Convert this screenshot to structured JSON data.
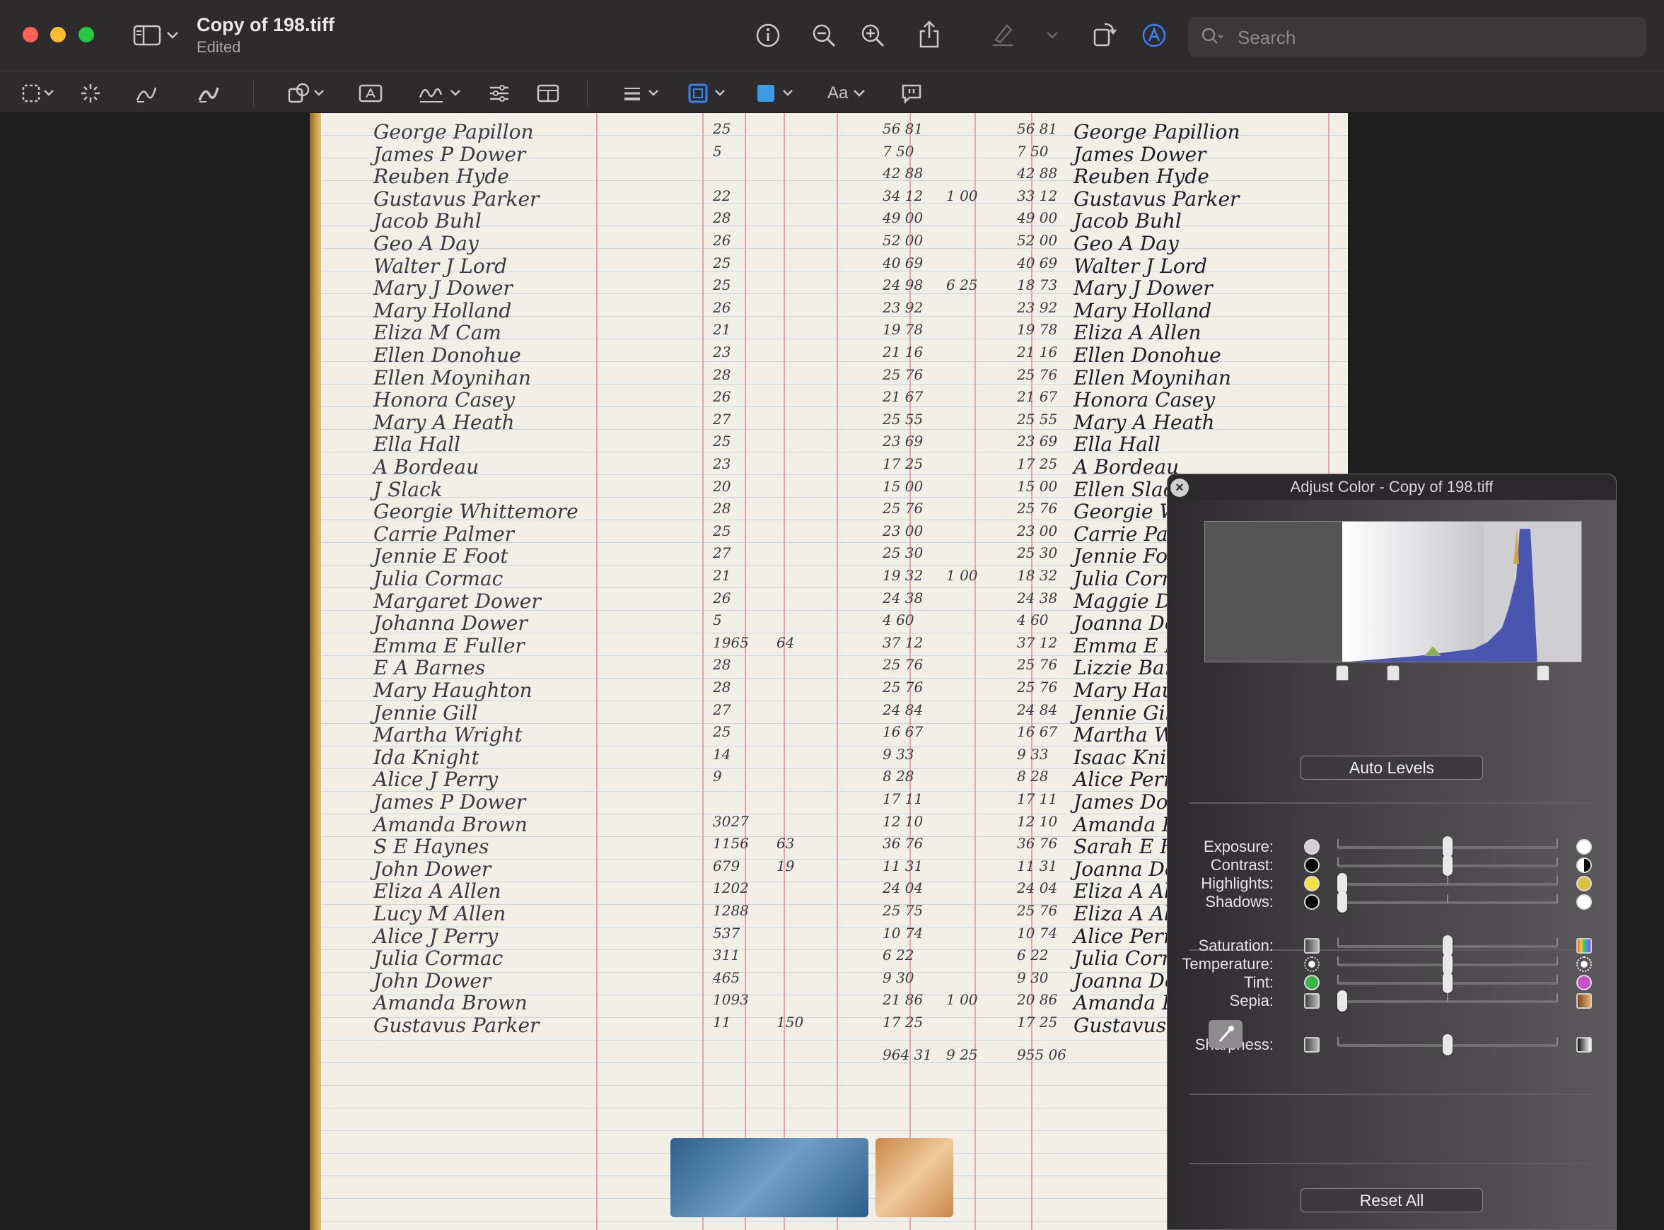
{
  "window": {
    "title": "Copy of 198.tiff",
    "subtitle": "Edited"
  },
  "titlebar_icons": [
    "sidebar-icon",
    "info-icon",
    "zoom-out-icon",
    "zoom-in-icon",
    "share-icon",
    "highlight-pen-icon",
    "rotate-icon",
    "markup-icon"
  ],
  "search": {
    "placeholder": "Search"
  },
  "toolbar": {
    "text_style_label": "Aa"
  },
  "ledger": {
    "rows": [
      {
        "name": "George Papillon",
        "a": "25",
        "b": "",
        "c": "56 81",
        "d": "",
        "e": "56 81",
        "sig": "George Papillion"
      },
      {
        "name": "James P Dower",
        "a": "5",
        "b": "",
        "c": "7 50",
        "d": "",
        "e": "7 50",
        "sig": "James Dower"
      },
      {
        "name": "Reuben Hyde",
        "a": "",
        "b": "",
        "c": "42 88",
        "d": "",
        "e": "42 88",
        "sig": "Reuben Hyde"
      },
      {
        "name": "Gustavus Parker",
        "a": "22",
        "b": "",
        "c": "34 12",
        "d": "1 00",
        "e": "33 12",
        "sig": "Gustavus Parker"
      },
      {
        "name": "Jacob Buhl",
        "a": "28",
        "b": "",
        "c": "49 00",
        "d": "",
        "e": "49 00",
        "sig": "Jacob Buhl"
      },
      {
        "name": "Geo A Day",
        "a": "26",
        "b": "",
        "c": "52 00",
        "d": "",
        "e": "52 00",
        "sig": "Geo A Day"
      },
      {
        "name": "Walter J Lord",
        "a": "25",
        "b": "",
        "c": "40 69",
        "d": "",
        "e": "40 69",
        "sig": "Walter J Lord"
      },
      {
        "name": "Mary J Dower",
        "a": "25",
        "b": "",
        "c": "24 98",
        "d": "6 25",
        "e": "18 73",
        "sig": "Mary J Dower"
      },
      {
        "name": "Mary Holland",
        "a": "26",
        "b": "",
        "c": "23 92",
        "d": "",
        "e": "23 92",
        "sig": "Mary Holland"
      },
      {
        "name": "Eliza M Cam",
        "a": "21",
        "b": "",
        "c": "19 78",
        "d": "",
        "e": "19 78",
        "sig": "Eliza A Allen"
      },
      {
        "name": "Ellen Donohue",
        "a": "23",
        "b": "",
        "c": "21 16",
        "d": "",
        "e": "21 16",
        "sig": "Ellen Donohue"
      },
      {
        "name": "Ellen Moynihan",
        "a": "28",
        "b": "",
        "c": "25 76",
        "d": "",
        "e": "25 76",
        "sig": "Ellen Moynihan"
      },
      {
        "name": "Honora Casey",
        "a": "26",
        "b": "",
        "c": "21 67",
        "d": "",
        "e": "21 67",
        "sig": "Honora Casey"
      },
      {
        "name": "Mary A Heath",
        "a": "27",
        "b": "",
        "c": "25 55",
        "d": "",
        "e": "25 55",
        "sig": "Mary A Heath"
      },
      {
        "name": "Ella Hall",
        "a": "25",
        "b": "",
        "c": "23 69",
        "d": "",
        "e": "23 69",
        "sig": "Ella Hall"
      },
      {
        "name": "A Bordeau",
        "a": "23",
        "b": "",
        "c": "17 25",
        "d": "",
        "e": "17 25",
        "sig": "A Bordeau"
      },
      {
        "name": "J Slack",
        "a": "20",
        "b": "",
        "c": "15 00",
        "d": "",
        "e": "15 00",
        "sig": "Ellen Slack"
      },
      {
        "name": "Georgie Whittemore",
        "a": "28",
        "b": "",
        "c": "25 76",
        "d": "",
        "e": "25 76",
        "sig": "Georgie Whittemore"
      },
      {
        "name": "Carrie Palmer",
        "a": "25",
        "b": "",
        "c": "23 00",
        "d": "",
        "e": "23 00",
        "sig": "Carrie Palmer"
      },
      {
        "name": "Jennie E Foot",
        "a": "27",
        "b": "",
        "c": "25 30",
        "d": "",
        "e": "25 30",
        "sig": "Jennie Foot"
      },
      {
        "name": "Julia Cormac",
        "a": "21",
        "b": "",
        "c": "19 32",
        "d": "1 00",
        "e": "18 32",
        "sig": "Julia Cormac"
      },
      {
        "name": "Margaret Dower",
        "a": "26",
        "b": "",
        "c": "24 38",
        "d": "",
        "e": "24 38",
        "sig": "Maggie Dower"
      },
      {
        "name": "Johanna Dower",
        "a": "5",
        "b": "",
        "c": "4 60",
        "d": "",
        "e": "4 60",
        "sig": "Joanna Dower"
      },
      {
        "name": "Emma E Fuller",
        "a": "1965",
        "b": "64",
        "c": "37 12",
        "d": "",
        "e": "37 12",
        "sig": "Emma E Fuller"
      },
      {
        "name": "E A Barnes",
        "a": "28",
        "b": "",
        "c": "25 76",
        "d": "",
        "e": "25 76",
        "sig": "Lizzie Barnes"
      },
      {
        "name": "Mary Haughton",
        "a": "28",
        "b": "",
        "c": "25 76",
        "d": "",
        "e": "25 76",
        "sig": "Mary Haughton"
      },
      {
        "name": "Jennie Gill",
        "a": "27",
        "b": "",
        "c": "24 84",
        "d": "",
        "e": "24 84",
        "sig": "Jennie Gill"
      },
      {
        "name": "Martha Wright",
        "a": "25",
        "b": "",
        "c": "16 67",
        "d": "",
        "e": "16 67",
        "sig": "Martha Wright"
      },
      {
        "name": "Ida Knight",
        "a": "14",
        "b": "",
        "c": "9 33",
        "d": "",
        "e": "9 33",
        "sig": "Isaac Knight"
      },
      {
        "name": "Alice J Perry",
        "a": "9",
        "b": "",
        "c": "8 28",
        "d": "",
        "e": "8 28",
        "sig": "Alice Perry"
      },
      {
        "name": "James P Dower",
        "a": "",
        "b": "",
        "c": "17 11",
        "d": "",
        "e": "17 11",
        "sig": "James Dower"
      },
      {
        "name": "Amanda Brown",
        "a": "3027",
        "b": "",
        "c": "12 10",
        "d": "",
        "e": "12 10",
        "sig": "Amanda Brown"
      },
      {
        "name": "S E Haynes",
        "a": "1156",
        "b": "63",
        "c": "36 76",
        "d": "",
        "e": "36 76",
        "sig": "Sarah E Haynes"
      },
      {
        "name": "John Dower",
        "a": "679",
        "b": "19",
        "c": "11 31",
        "d": "",
        "e": "11 31",
        "sig": "Joanna Dower"
      },
      {
        "name": "Eliza A Allen",
        "a": "1202",
        "b": "",
        "c": "24 04",
        "d": "",
        "e": "24 04",
        "sig": "Eliza A Allen"
      },
      {
        "name": "Lucy M Allen",
        "a": "1288",
        "b": "",
        "c": "25 75",
        "d": "",
        "e": "25 76",
        "sig": "Eliza A Allen"
      },
      {
        "name": "Alice J Perry",
        "a": "537",
        "b": "",
        "c": "10 74",
        "d": "",
        "e": "10 74",
        "sig": "Alice Perry"
      },
      {
        "name": "Julia Cormac",
        "a": "311",
        "b": "",
        "c": "6 22",
        "d": "",
        "e": "6 22",
        "sig": "Julia Cormac"
      },
      {
        "name": "John Dower",
        "a": "465",
        "b": "",
        "c": "9 30",
        "d": "",
        "e": "9 30",
        "sig": "Joanna Dower"
      },
      {
        "name": "Amanda Brown",
        "a": "1093",
        "b": "",
        "c": "21 86",
        "d": "1 00",
        "e": "20 86",
        "sig": "Amanda Brown"
      },
      {
        "name": "Gustavus Parker",
        "a": "11",
        "b": "150",
        "c": "17 25",
        "d": "",
        "e": "17 25",
        "sig": "Gustavus Parker"
      }
    ],
    "totals": {
      "c": "964 31",
      "d": "9 25",
      "e": "955 06"
    }
  },
  "adjust_color": {
    "title": "Adjust Color - Copy of 198.tiff",
    "auto_levels_label": "Auto Levels",
    "reset_all_label": "Reset All",
    "sliders": [
      {
        "key": "exposure",
        "label": "Exposure:",
        "value": 0.5
      },
      {
        "key": "contrast",
        "label": "Contrast:",
        "value": 0.5
      },
      {
        "key": "highlights",
        "label": "Highlights:",
        "value": 0.0
      },
      {
        "key": "shadows",
        "label": "Shadows:",
        "value": 0.0
      },
      {
        "key": "saturation",
        "label": "Saturation:",
        "value": 0.5
      },
      {
        "key": "temperature",
        "label": "Temperature:",
        "value": 0.5
      },
      {
        "key": "tint",
        "label": "Tint:",
        "value": 0.5
      },
      {
        "key": "sepia",
        "label": "Sepia:",
        "value": 0.0
      },
      {
        "key": "sharpness",
        "label": "Sharpness:",
        "value": 0.5
      }
    ],
    "levels": {
      "black_point": 0.365,
      "mid_point": 0.5,
      "white_point": 0.9
    }
  },
  "colors": {
    "close": "#fe5f57",
    "minimize": "#febc2e",
    "maximize": "#28c840",
    "accent": "#3b82f6"
  }
}
